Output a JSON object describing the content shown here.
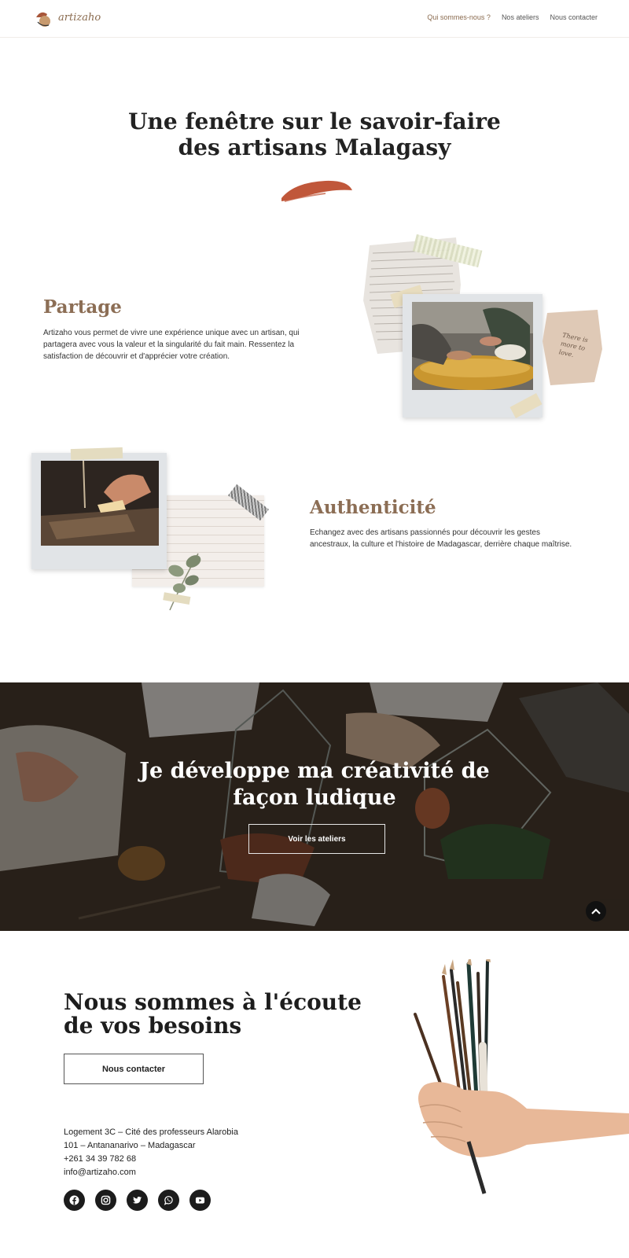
{
  "header": {
    "logo_text": "artizaho",
    "nav": [
      {
        "label": "Qui sommes-nous ?"
      },
      {
        "label": "Nos ateliers"
      },
      {
        "label": "Nous contacter"
      }
    ]
  },
  "hero": {
    "title_line1": "Une fenêtre sur le savoir-faire",
    "title_line2": "des artisans Malagasy"
  },
  "partage": {
    "title": "Partage",
    "text": "Artizaho vous permet de vivre une expérience unique avec un artisan, qui partagera avec vous la valeur et la singularité du fait main. Ressentez la satisfaction de découvrir et d'apprécier votre création.",
    "note_text": "There is more to love."
  },
  "authenticite": {
    "title": "Authenticité",
    "text": "Echangez avec des artisans passionnés pour découvrir les gestes ancestraux, la culture et l'histoire de Madagascar, derrière chaque maîtrise."
  },
  "banner": {
    "title_line1": "Je développe ma créativité de",
    "title_line2": "façon ludique",
    "button_label": "Voir les ateliers"
  },
  "contact": {
    "title_line1": "Nous sommes à l'écoute",
    "title_line2": "de vos besoins",
    "button_label": "Nous contacter",
    "address_line1": "Logement 3C – Cité des professeurs Alarobia",
    "address_line2": "101 – Antananarivo – Madagascar",
    "phone": "+261 34 39 782 68",
    "email": "info@artizaho.com",
    "socials": [
      "facebook-icon",
      "instagram-icon",
      "twitter-icon",
      "whatsapp-icon",
      "youtube-icon"
    ]
  },
  "colors": {
    "accent_brown": "#8c6e55",
    "brush_red": "#c0573a",
    "dark": "#1c1c1c"
  }
}
